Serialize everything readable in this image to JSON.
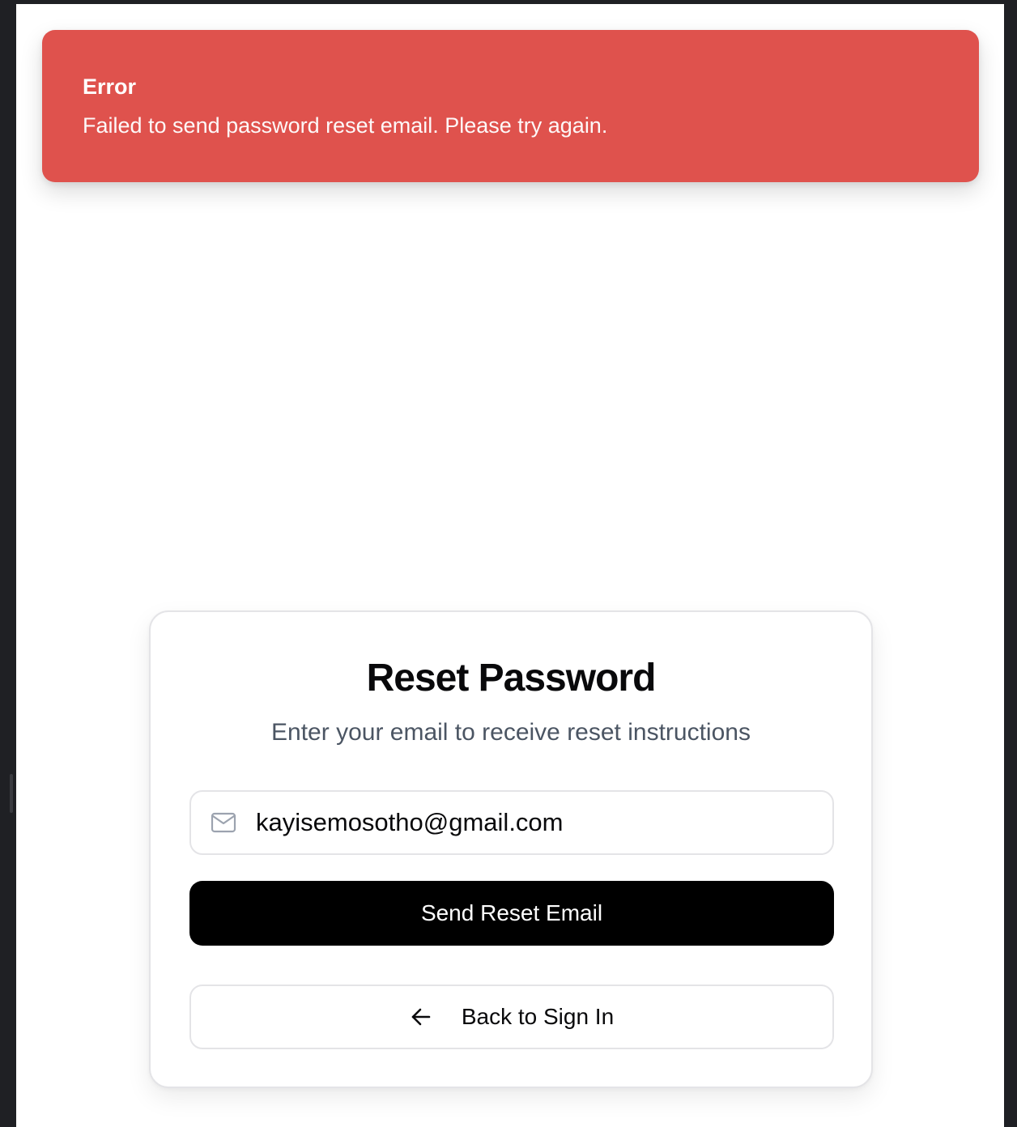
{
  "toast": {
    "title": "Error",
    "message": "Failed to send password reset email. Please try again."
  },
  "reset_form": {
    "title": "Reset Password",
    "subtitle": "Enter your email to receive reset instructions",
    "email": {
      "icon": "mail-icon",
      "value": "kayisemosotho@gmail.com",
      "type": "email"
    },
    "send_button_label": "Send Reset Email",
    "back_button": {
      "icon": "arrow-left-icon",
      "label": "Back to Sign In"
    }
  },
  "colors": {
    "error_background": "#df524d",
    "primary_button": "#000000",
    "border": "#e4e4e7",
    "muted_text": "#4b5563"
  }
}
